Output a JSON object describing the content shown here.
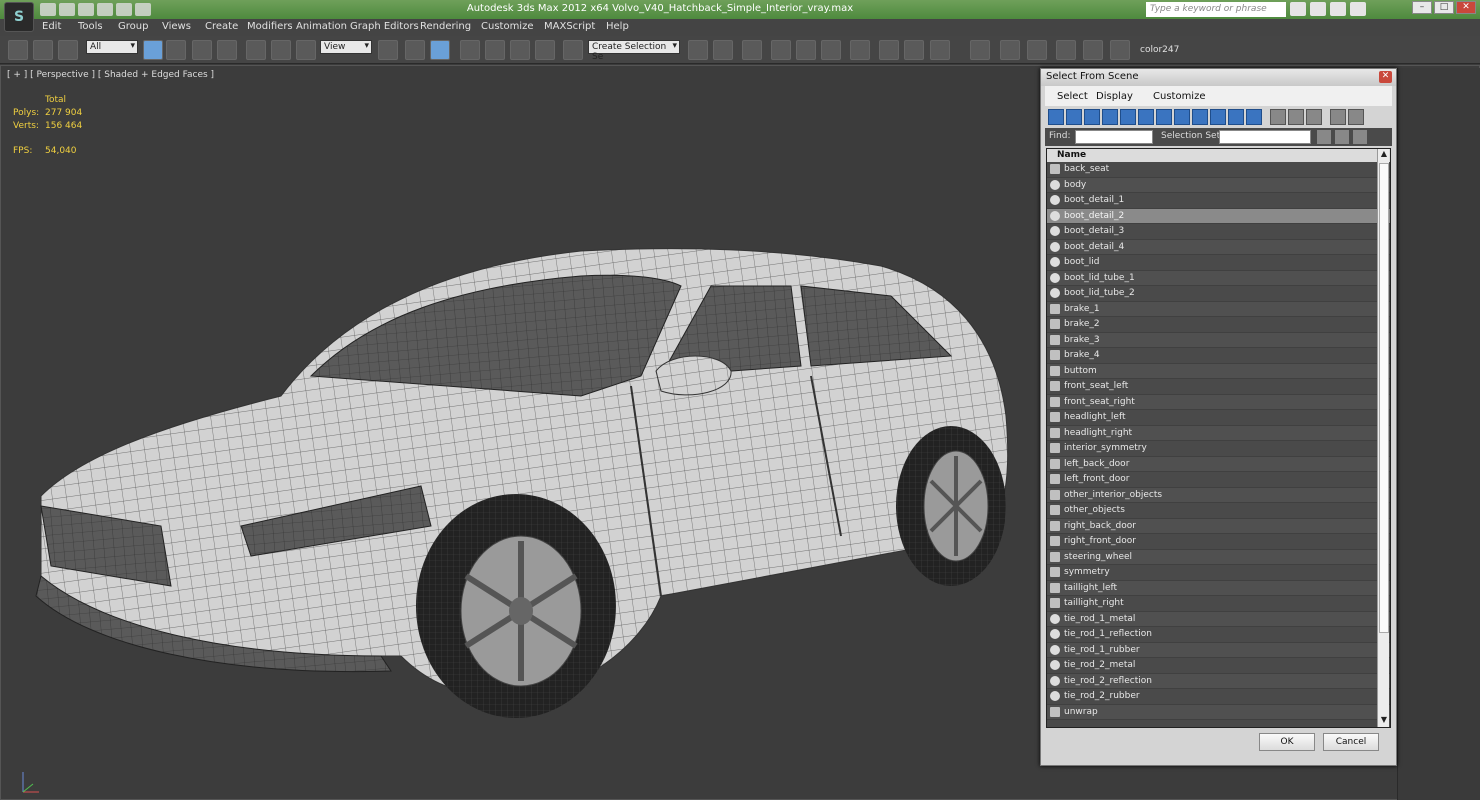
{
  "window": {
    "title": "Autodesk 3ds Max 2012 x64     Volvo_V40_Hatchback_Simple_Interior_vray.max"
  },
  "search": {
    "placeholder": "Type a keyword or phrase"
  },
  "menu": [
    "Edit",
    "Tools",
    "Group",
    "Views",
    "Create",
    "Modifiers",
    "Animation",
    "Graph Editors",
    "Rendering",
    "Customize",
    "MAXScript",
    "Help"
  ],
  "toolbar": {
    "filter_value": "All",
    "ref_coord_value": "View",
    "selection_set_value": "Create Selection Se",
    "color_label": "color247"
  },
  "viewport": {
    "label": "[ + ] [ Perspective ] [ Shaded + Edged Faces ]",
    "stats": {
      "header": "Total",
      "polys_label": "Polys:",
      "polys_value": "277 904",
      "verts_label": "Verts:",
      "verts_value": "156 464",
      "fps_label": "FPS:",
      "fps_value": "54,040"
    }
  },
  "dialog": {
    "title": "Select From Scene",
    "menu": [
      "Select",
      "Display",
      "Customize"
    ],
    "find_label": "Find:",
    "find_value": "",
    "selection_set_label": "Selection Set:",
    "selection_set_value": "",
    "column_header": "Name",
    "ok_label": "OK",
    "cancel_label": "Cancel",
    "selected_item": "boot_detail_2",
    "items": [
      {
        "name": "back_seat",
        "icon": "group-icon"
      },
      {
        "name": "body",
        "icon": "sphere-icon"
      },
      {
        "name": "boot_detail_1",
        "icon": "sphere-icon"
      },
      {
        "name": "boot_detail_2",
        "icon": "sphere-icon"
      },
      {
        "name": "boot_detail_3",
        "icon": "sphere-icon"
      },
      {
        "name": "boot_detail_4",
        "icon": "sphere-icon"
      },
      {
        "name": "boot_lid",
        "icon": "sphere-icon"
      },
      {
        "name": "boot_lid_tube_1",
        "icon": "sphere-icon"
      },
      {
        "name": "boot_lid_tube_2",
        "icon": "sphere-icon"
      },
      {
        "name": "brake_1",
        "icon": "group-icon"
      },
      {
        "name": "brake_2",
        "icon": "group-icon"
      },
      {
        "name": "brake_3",
        "icon": "group-icon"
      },
      {
        "name": "brake_4",
        "icon": "group-icon"
      },
      {
        "name": "buttom",
        "icon": "group-icon"
      },
      {
        "name": "front_seat_left",
        "icon": "group-icon"
      },
      {
        "name": "front_seat_right",
        "icon": "group-icon"
      },
      {
        "name": "headlight_left",
        "icon": "group-icon"
      },
      {
        "name": "headlight_right",
        "icon": "group-icon"
      },
      {
        "name": "interior_symmetry",
        "icon": "group-icon"
      },
      {
        "name": "left_back_door",
        "icon": "group-icon"
      },
      {
        "name": "left_front_door",
        "icon": "group-icon"
      },
      {
        "name": "other_interior_objects",
        "icon": "group-icon"
      },
      {
        "name": "other_objects",
        "icon": "group-icon"
      },
      {
        "name": "right_back_door",
        "icon": "group-icon"
      },
      {
        "name": "right_front_door",
        "icon": "group-icon"
      },
      {
        "name": "steering_wheel",
        "icon": "group-icon"
      },
      {
        "name": "symmetry",
        "icon": "group-icon"
      },
      {
        "name": "taillight_left",
        "icon": "group-icon"
      },
      {
        "name": "taillight_right",
        "icon": "group-icon"
      },
      {
        "name": "tie_rod_1_metal",
        "icon": "sphere-icon"
      },
      {
        "name": "tie_rod_1_reflection",
        "icon": "sphere-icon"
      },
      {
        "name": "tie_rod_1_rubber",
        "icon": "sphere-icon"
      },
      {
        "name": "tie_rod_2_metal",
        "icon": "sphere-icon"
      },
      {
        "name": "tie_rod_2_reflection",
        "icon": "sphere-icon"
      },
      {
        "name": "tie_rod_2_rubber",
        "icon": "sphere-icon"
      },
      {
        "name": "unwrap",
        "icon": "group-icon"
      }
    ]
  }
}
